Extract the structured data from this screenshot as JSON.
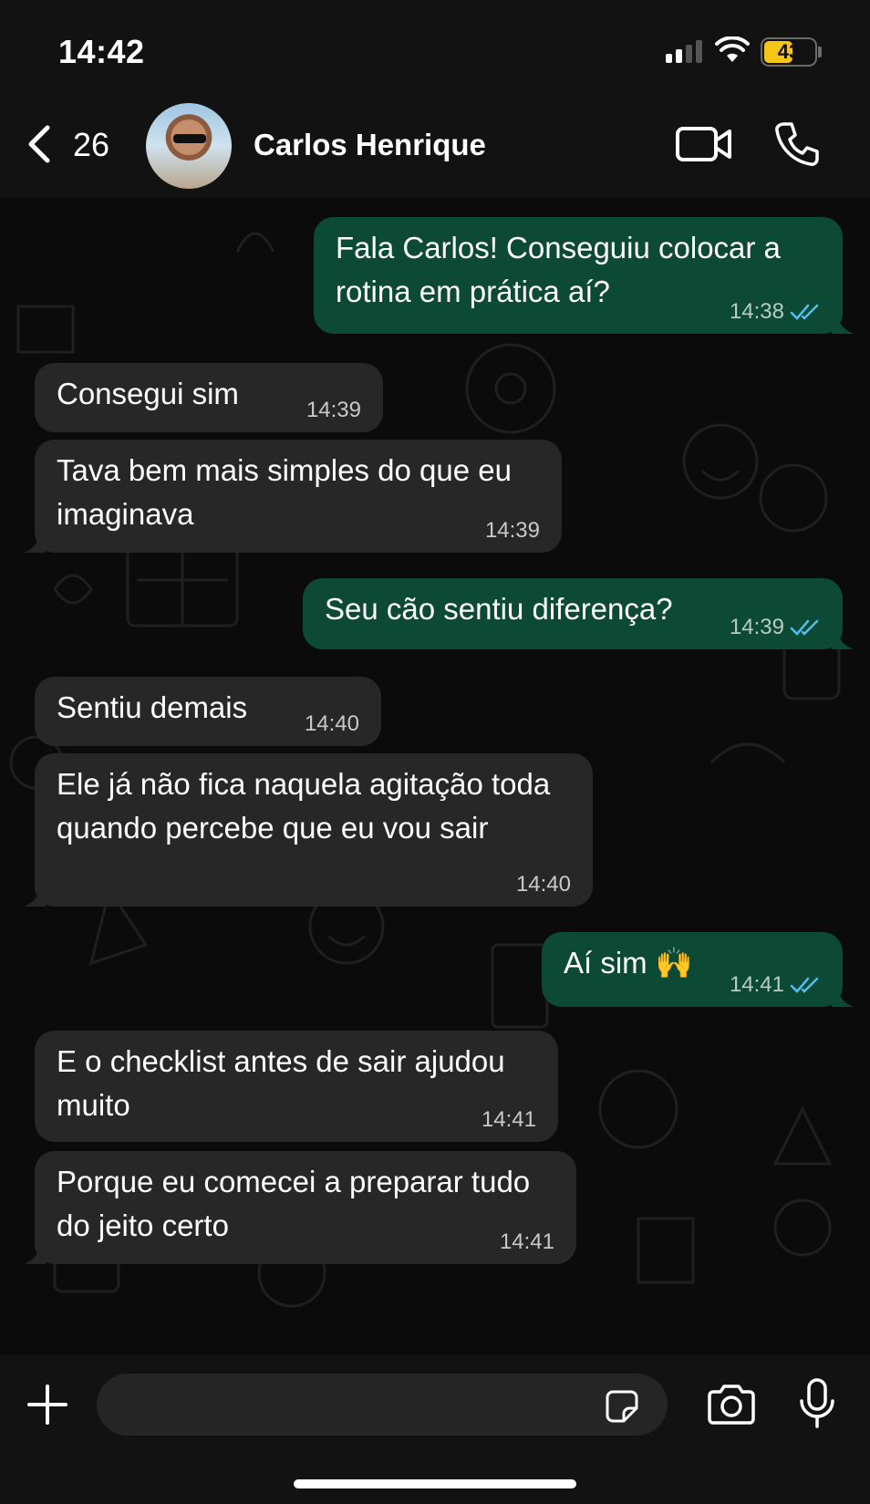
{
  "status_bar": {
    "time": "14:42",
    "battery": "43"
  },
  "header": {
    "back_count": "26",
    "contact_name": "Carlos Henrique",
    "icons": [
      "back-icon",
      "video-call-icon",
      "phone-call-icon"
    ]
  },
  "colors": {
    "outgoing_bubble": "#0c4a36",
    "incoming_bubble": "#272727",
    "background": "#0b0b0b",
    "battery": "#f5c518",
    "read_ticks": "#53bdeb"
  },
  "messages": [
    {
      "direction": "outgoing",
      "text": "Fala Carlos! Conseguiu colocar a rotina em prática aí?",
      "time": "14:38",
      "status": "read"
    },
    {
      "direction": "incoming",
      "text": "Consegui sim",
      "time": "14:39"
    },
    {
      "direction": "incoming",
      "text": "Tava bem mais simples do que eu imaginava",
      "time": "14:39"
    },
    {
      "direction": "outgoing",
      "text": "Seu cão sentiu diferença?",
      "time": "14:39",
      "status": "read"
    },
    {
      "direction": "incoming",
      "text": "Sentiu demais",
      "time": "14:40"
    },
    {
      "direction": "incoming",
      "text": "Ele já não fica naquela agitação toda quando percebe que eu vou sair",
      "time": "14:40"
    },
    {
      "direction": "outgoing",
      "text": "Aí sim 🙌",
      "time": "14:41",
      "status": "read"
    },
    {
      "direction": "incoming",
      "text": "E o checklist antes de sair ajudou muito",
      "time": "14:41"
    },
    {
      "direction": "incoming",
      "text": "Porque eu comecei a preparar tudo do jeito certo",
      "time": "14:41"
    }
  ],
  "input_bar": {
    "placeholder": "",
    "icons": [
      "plus-icon",
      "sticker-icon",
      "camera-icon",
      "microphone-icon"
    ]
  }
}
